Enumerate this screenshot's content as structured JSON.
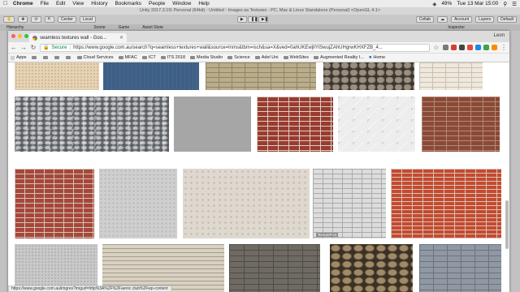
{
  "menubar": {
    "app": "Chrome",
    "items": [
      "File",
      "Edit",
      "View",
      "History",
      "Bookmarks",
      "People",
      "Window",
      "Help"
    ],
    "battery": "49%",
    "clock": "Tue 13 Mar 15:00"
  },
  "unity": {
    "title": "Unity 2017.3.1f1 Personal (64bit) - Untitled - Images as Textures - PC, Mac & Linux Standalone (Personal) <OpenGL 4.1>",
    "center": "Center",
    "local": "Local",
    "collab": "Collab",
    "account": "Account",
    "layers": "Layers",
    "layout": "Default",
    "tabs": [
      "Hierarchy",
      "Scene",
      "Game",
      "Asset Store",
      "Inspector"
    ]
  },
  "chrome": {
    "tab_title": "seamless textures wall - Goo...",
    "user": "Leon",
    "secure_label": "Secure",
    "url": "https://www.google.com.au/search?q=seamless+textures+wall&source=lnms&tbm=isch&sa=X&ved=0ahUKEwjlIYiSwujZAhUHgrwKHXFZB_4...",
    "bookmarks": [
      {
        "label": "Apps",
        "kind": "apps"
      },
      {
        "label": "",
        "kind": "folder"
      },
      {
        "label": "",
        "kind": "folder"
      },
      {
        "label": "",
        "kind": "folder"
      },
      {
        "label": "",
        "kind": "folder"
      },
      {
        "label": "Cloud Services",
        "kind": "folder"
      },
      {
        "label": "MFAC",
        "kind": "folder"
      },
      {
        "label": "ICT",
        "kind": "folder"
      },
      {
        "label": "ITS 2018",
        "kind": "folder"
      },
      {
        "label": "Media Studio",
        "kind": "folder"
      },
      {
        "label": "Science",
        "kind": "folder"
      },
      {
        "label": "Adel Uni",
        "kind": "folder"
      },
      {
        "label": "WebSites",
        "kind": "folder"
      },
      {
        "label": "Augmented Reality I...",
        "kind": "folder"
      },
      {
        "label": "Home",
        "kind": "link"
      }
    ],
    "status_url": "https://www.google.com.au/imgres?imgurl=http%3A%2F%2Faeroc.club%2Fwp-content",
    "watermark": "TexturePics"
  },
  "tiles": [
    {
      "name": "sand",
      "tex": "t-sand"
    },
    {
      "name": "blue-paint",
      "tex": "t-blue"
    },
    {
      "name": "tan-brick",
      "tex": "t-tan"
    },
    {
      "name": "cobble-stone",
      "tex": "t-cobble"
    },
    {
      "name": "light-brick",
      "tex": "t-lightbrick"
    },
    {
      "name": "stone-wall",
      "tex": "t-stonewall"
    },
    {
      "name": "grey-plain",
      "tex": "t-grey"
    },
    {
      "name": "red-brick",
      "tex": "t-redbrick"
    },
    {
      "name": "white-plaster",
      "tex": "t-white-plaster"
    },
    {
      "name": "brown-brick",
      "tex": "t-brownbrick"
    },
    {
      "name": "red-brick-2",
      "tex": "t-redbrick2"
    },
    {
      "name": "concrete",
      "tex": "t-concrete"
    },
    {
      "name": "grunge-wall",
      "tex": "t-grunge"
    },
    {
      "name": "white-brick",
      "tex": "t-whitebrick"
    },
    {
      "name": "orange-brick",
      "tex": "t-orangebrick"
    },
    {
      "name": "light-grey",
      "tex": "t-lightgrey"
    },
    {
      "name": "layered-stone",
      "tex": "t-layered"
    },
    {
      "name": "grey-stone",
      "tex": "t-greystone"
    },
    {
      "name": "flagstone",
      "tex": "t-flagstone"
    },
    {
      "name": "blue-stone",
      "tex": "t-bluestone"
    }
  ]
}
